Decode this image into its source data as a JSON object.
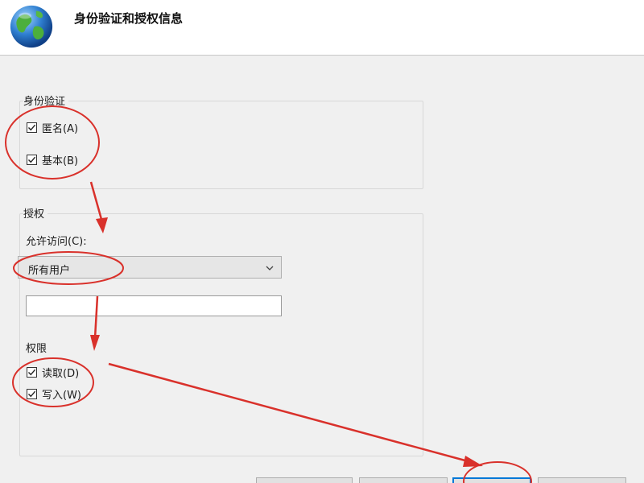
{
  "dialog": {
    "title": "身份验证和授权信息"
  },
  "authentication": {
    "group_label": "身份验证",
    "options": [
      {
        "label": "匿名(A)",
        "checked": true
      },
      {
        "label": "基本(B)",
        "checked": true
      }
    ]
  },
  "authorization": {
    "group_label": "授权",
    "allow_access_label": "允许访问(C):",
    "allow_access_value": "所有用户",
    "user_input_value": "",
    "permissions_label": "权限",
    "permissions": [
      {
        "label": "读取(D)",
        "checked": true
      },
      {
        "label": "写入(W)",
        "checked": true
      }
    ]
  },
  "colors": {
    "annotation": "#d9312b",
    "primary_border": "#0078d7"
  },
  "icons": {
    "header": "globe-icon",
    "dropdown": "chevron-down-icon",
    "checkbox": "checkmark-icon"
  }
}
